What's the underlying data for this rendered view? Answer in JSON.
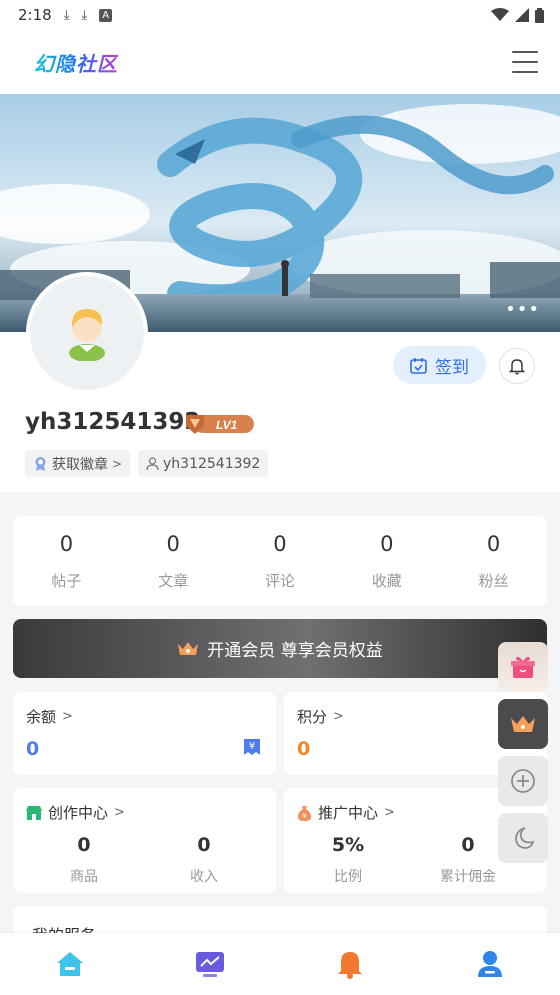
{
  "status_bar": {
    "time": "2:18",
    "icons": [
      "download-icon",
      "download-icon",
      "font-icon"
    ],
    "right_icons": [
      "wifi-icon",
      "signal-icon",
      "battery-icon"
    ]
  },
  "header": {
    "logo_text": "幻隐社区",
    "menu_icon": "hamburger-menu-icon"
  },
  "banner": {
    "more_label": "•••"
  },
  "profile": {
    "username": "yh312541392",
    "level": "LV1",
    "checkin_label": "签到",
    "badge_tag_label": "获取徽章",
    "id_tag_label": "yh312541392"
  },
  "stats": [
    {
      "value": "0",
      "label": "帖子"
    },
    {
      "value": "0",
      "label": "文章"
    },
    {
      "value": "0",
      "label": "评论"
    },
    {
      "value": "0",
      "label": "收藏"
    },
    {
      "value": "0",
      "label": "粉丝"
    }
  ],
  "vip_banner": {
    "label": "开通会员 尊享会员权益"
  },
  "balance": {
    "title": "余额",
    "value": "0"
  },
  "points": {
    "title": "积分",
    "value": "0"
  },
  "creator": {
    "title": "创作中心",
    "items": [
      {
        "value": "0",
        "label": "商品"
      },
      {
        "value": "0",
        "label": "收入"
      }
    ]
  },
  "promotion": {
    "title": "推广中心",
    "items": [
      {
        "value": "5%",
        "label": "比例"
      },
      {
        "value": "0",
        "label": "累计佣金"
      }
    ]
  },
  "services": {
    "title": "我的服务"
  },
  "colors": {
    "accent_blue": "#2d6fe0",
    "accent_orange": "#f08a24",
    "level_badge": "#d9804b"
  },
  "bottom_nav": [
    "home-icon",
    "trend-icon",
    "notification-icon",
    "profile-icon"
  ],
  "float_buttons": [
    "gift-icon",
    "crown-icon",
    "add-icon",
    "dark-mode-icon"
  ]
}
